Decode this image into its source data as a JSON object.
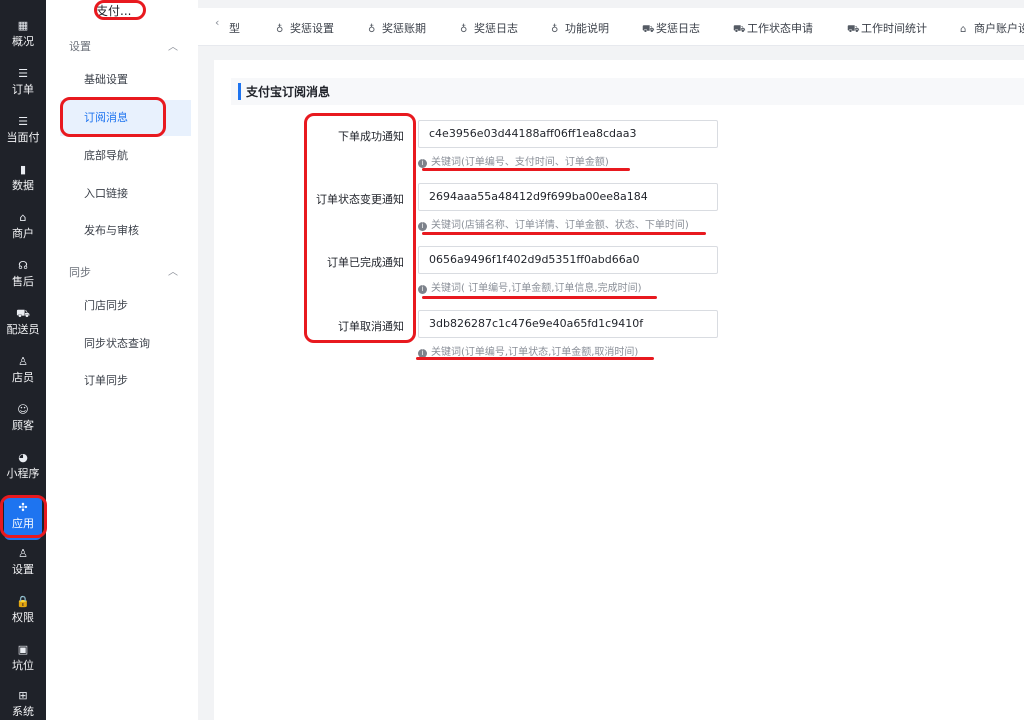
{
  "rail": [
    {
      "icon": "dashboard-icon",
      "glyph": "▦",
      "label": "概况"
    },
    {
      "icon": "list-icon",
      "glyph": "☰",
      "label": "订单"
    },
    {
      "icon": "list-icon",
      "glyph": "☰",
      "label": "当面付"
    },
    {
      "icon": "bar-chart-icon",
      "glyph": "▮",
      "label": "数据"
    },
    {
      "icon": "store-icon",
      "glyph": "⌂",
      "label": "商户"
    },
    {
      "icon": "headset-icon",
      "glyph": "☊",
      "label": "售后"
    },
    {
      "icon": "truck-icon",
      "glyph": "⛟",
      "label": "配送员"
    },
    {
      "icon": "staff-icon",
      "glyph": "♙",
      "label": "店员"
    },
    {
      "icon": "customer-icon",
      "glyph": "☺",
      "label": "顾客"
    },
    {
      "icon": "wechat-icon",
      "glyph": "◕",
      "label": "小程序"
    },
    {
      "icon": "apps-icon",
      "glyph": "✣",
      "label": "应用"
    },
    {
      "icon": "user-settings-icon",
      "glyph": "♙",
      "label": "设置"
    },
    {
      "icon": "lock-icon",
      "glyph": "🔒",
      "label": "权限"
    },
    {
      "icon": "grid-icon",
      "glyph": "▣",
      "label": "坑位"
    },
    {
      "icon": "windows-icon",
      "glyph": "⊞",
      "label": "系统"
    }
  ],
  "subnav": {
    "header": "支付...",
    "groups": [
      {
        "label": "设置",
        "items": [
          "基础设置",
          "订阅消息",
          "底部导航",
          "入口链接",
          "发布与审核"
        ]
      },
      {
        "label": "同步",
        "items": [
          "门店同步",
          "同步状态查询",
          "订单同步"
        ]
      }
    ]
  },
  "tabs": [
    "型",
    "奖惩设置",
    "奖惩账期",
    "奖惩日志",
    "功能说明",
    "奖惩日志",
    "工作状态申请",
    "工作时间统计",
    "商户账户设"
  ],
  "section_title": "支付宝订阅消息",
  "rows": [
    {
      "label": "下单成功通知",
      "value": "c4e3956e03d44188aff06ff1ea8cdaa3",
      "hint": "关键词(订单编号、支付时间、订单金额)"
    },
    {
      "label": "订单状态变更通知",
      "value": "2694aaa55a48412d9f699ba00ee8a184",
      "hint": "关键词(店铺名称、订单详情、订单金额、状态、下单时间)"
    },
    {
      "label": "订单已完成通知",
      "value": "0656a9496f1f402d9d5351ff0abd66a0",
      "hint": "关键词( 订单编号,订单金额,订单信息,完成时间)"
    },
    {
      "label": "订单取消通知",
      "value": "3db826287c1c476e9e40a65fd1c9410f",
      "hint": "关键词(订单编号,订单状态,订单金额,取消时间)"
    }
  ],
  "colors": {
    "accent": "#1e74f0",
    "annotation": "#e8191f",
    "rail": "#1f2229"
  }
}
